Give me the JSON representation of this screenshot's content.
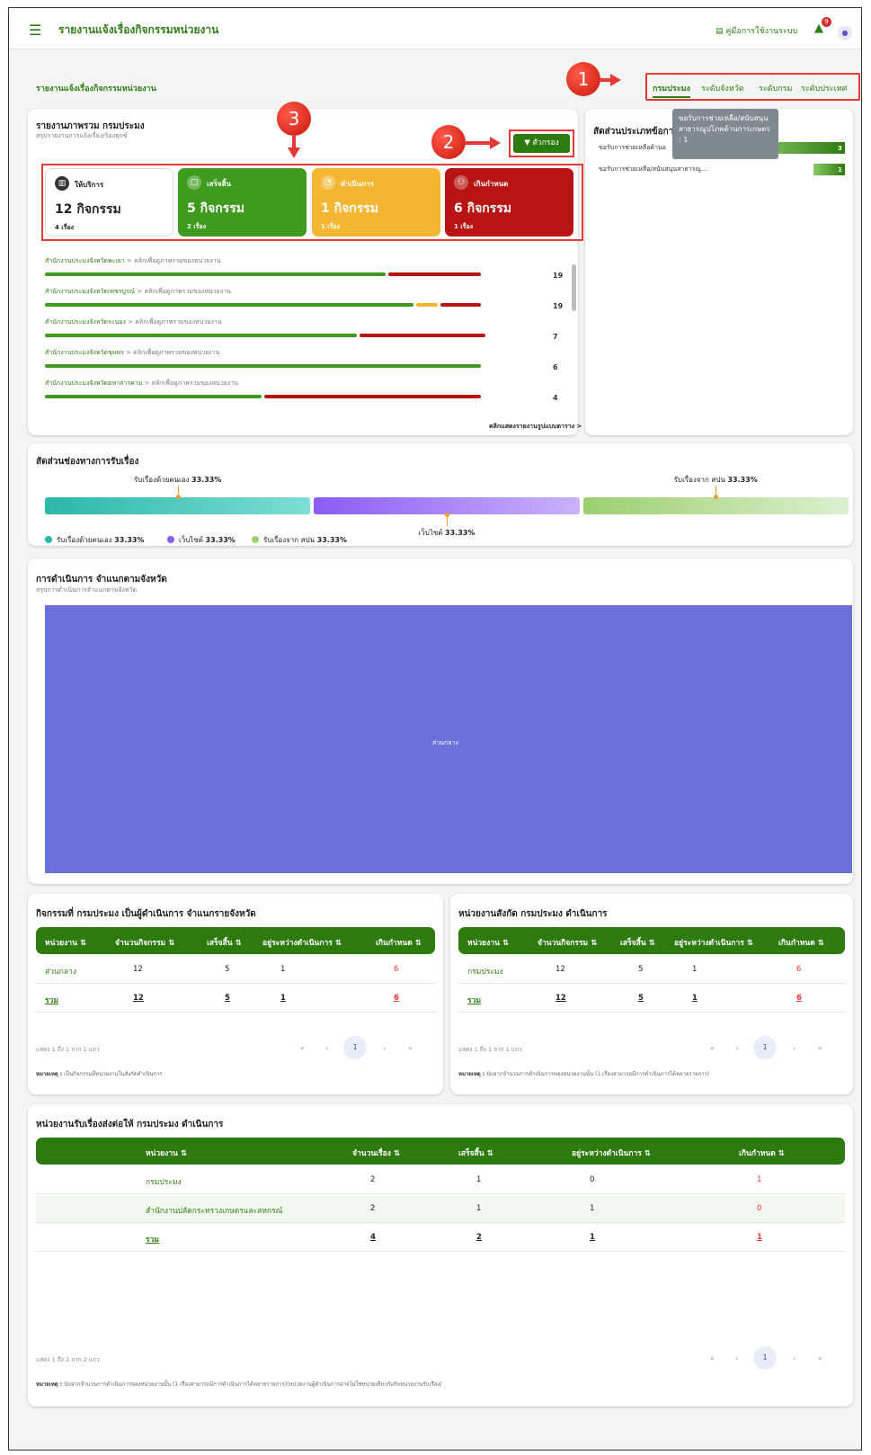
{
  "header": {
    "title": "รายงานแจ้งเรื่องกิจกรรมหน่วยงาน",
    "manual_label": "คู่มือการใช้งานระบบ",
    "notification_count": "9"
  },
  "page": {
    "heading": "รายงานแจ้งเรื่องกิจกรรมหน่วยงาน",
    "scope_tabs": [
      "กรมประมง",
      "ระดับจังหวัด",
      "ระดับกรม",
      "ระดับประเทศ"
    ],
    "markers": [
      "1",
      "2",
      "3"
    ]
  },
  "overview": {
    "title": "รายงานภาพรวม กรมประมง",
    "subtitle": "สรุปรายงานการแจ้งเรื่อง/ร้องทุกข์",
    "filter_label": "ตัวกรอง",
    "stats": [
      {
        "label": "ให้บริการ",
        "value": "12 กิจกรรม",
        "sub": "4 เรื่อง"
      },
      {
        "label": "เสร็จสิ้น",
        "value": "5 กิจกรรม",
        "sub": "2 เรื่อง"
      },
      {
        "label": "ดำเนินการ",
        "value": "1 กิจกรรม",
        "sub": "1 เรื่อง"
      },
      {
        "label": "เกินกำหนด",
        "value": "6 กิจกรรม",
        "sub": "1 เรื่อง"
      }
    ],
    "click_hint": " > คลิกเพื่อดูภาพรวมของหน่วยงาน",
    "orgs": [
      {
        "name": "สำนักงานประมงจังหวัดพะเยา",
        "value": "19",
        "green": 0.72,
        "yellow": 0,
        "red": 0.2
      },
      {
        "name": "สำนักงานประมงจังหวัดเพชรบูรณ์",
        "value": "19",
        "green": 0.78,
        "yellow": 0.05,
        "red": 0.09
      },
      {
        "name": "สำนักงานประมงจังหวัดระนอง",
        "value": "7",
        "green": 0.66,
        "yellow": 0,
        "red": 0.27
      },
      {
        "name": "สำนักงานประมงจังหวัดชุมพร",
        "value": "6",
        "green": 0.92,
        "yellow": 0,
        "red": 0
      },
      {
        "name": "สำนักงานประมงจังหวัดมหาสารคาม",
        "value": "4",
        "green": 0.46,
        "yellow": 0,
        "red": 0.46
      }
    ],
    "more_link": "คลิกแสดงรายงานรูปแบบตาราง >"
  },
  "help_types": {
    "title": "สัดส่วนประเภทข้อการ",
    "tooltip": "ขอรับการช่วยเหลือ/สนับสนุนสาธารณูปโภคด้านการเกษตร : 1",
    "rows": [
      {
        "label": "ขอรับการช่วยเหลือด้านอ",
        "value": "3",
        "fraction": 1.0
      },
      {
        "label": "ขอรับการช่วยเหลือ/สนับสนุนสาธารณู...",
        "value": "1",
        "fraction": 0.33
      }
    ]
  },
  "channels": {
    "title": "สัดส่วนช่องทางการรับเรื่อง",
    "segments": [
      {
        "name": "รับเรื่องด้วยตนเอง",
        "percent": "33.33%",
        "share": 0.3333,
        "color": "#2ab7a9"
      },
      {
        "name": "เว็บไซต์",
        "percent": "33.33%",
        "share": 0.3333,
        "color": "#8b5cf6"
      },
      {
        "name": "รับเรื่องจาก สปน",
        "percent": "33.33%",
        "share": 0.3333,
        "color": "#9ccf6e"
      }
    ]
  },
  "province_ops": {
    "title": "การดำเนินการ จำแนกตามจังหวัด",
    "subtitle": "สรุปการดำเนินการจำแนกตามจังหวัด",
    "treemap_label": "ส่วนกลาง",
    "treemap_color": "#6b70db"
  },
  "table1": {
    "title": "กิจกรรมที่ กรมประมง เป็นผู้ดำเนินการ จำแนกรายจังหวัด",
    "headers": [
      "หน่วยงาน ⇅",
      "จำนวนกิจกรรม ⇅",
      "เสร็จสิ้น ⇅",
      "อยู่ระหว่างดำเนินการ ⇅",
      "เกินกำหนด ⇅"
    ],
    "rows": [
      [
        "ส่วนกลาง",
        "12",
        "5",
        "1",
        "6"
      ]
    ],
    "total": [
      "รวม",
      "12",
      "5",
      "1",
      "6"
    ],
    "page_info": "แสดง 1 ถึง 1 จาก 1 แถว",
    "note_label": "หมายเหตุ :",
    "note": " เป็นกิจกรรมที่หน่วยงานในสังกัดดำเนินการ"
  },
  "table2": {
    "title": "หน่วยงานสังกัด กรมประมง ดำเนินการ",
    "headers": [
      "หน่วยงาน ⇅",
      "จำนวนกิจกรรม ⇅",
      "เสร็จสิ้น ⇅",
      "อยู่ระหว่างดำเนินการ ⇅",
      "เกินกำหนด ⇅"
    ],
    "rows": [
      [
        "กรมประมง",
        "12",
        "5",
        "1",
        "6"
      ]
    ],
    "total": [
      "รวม",
      "12",
      "5",
      "1",
      "6"
    ],
    "page_info": "แสดง 1 ถึง 1 จาก 1 แถว",
    "note_label": "หมายเหตุ :",
    "note": " นับจากจำนวนการดำเนินการของหน่วยงานนั้น (1 เรื่องสามารถมีการดำเนินการได้หลายรายการ)"
  },
  "table3": {
    "title": "หน่วยงานรับเรื่องส่งต่อให้ กรมประมง ดำเนินการ",
    "headers": [
      "หน่วยงาน ⇅",
      "จำนวนเรื่อง ⇅",
      "เสร็จสิ้น ⇅",
      "อยู่ระหว่างดำเนินการ ⇅",
      "เกินกำหนด ⇅"
    ],
    "rows": [
      [
        "กรมประมง",
        "2",
        "1",
        "0",
        "1"
      ],
      [
        "สำนักงานปลัดกระทรวงเกษตรและสหกรณ์",
        "2",
        "1",
        "1",
        "0"
      ]
    ],
    "total": [
      "รวม",
      "4",
      "2",
      "1",
      "1"
    ],
    "page_info": "แสดง 1 ถึง 2 จาก 2 แถว",
    "note_label": "หมายเหตุ :",
    "note": " นับจากจำนวนการดำเนินการของหน่วยงานนั้น (1 เรื่องสามารถมีการดำเนินการได้หลายรายการ)(หน่วยงานผู้ดำเนินการอาจไม่ใช่หน่วยเดียวกับกับหน่วยงานรับเรื่อง)"
  },
  "pager": {
    "first": "«",
    "prev": "‹",
    "current": "1",
    "next": "›",
    "last": "»"
  }
}
